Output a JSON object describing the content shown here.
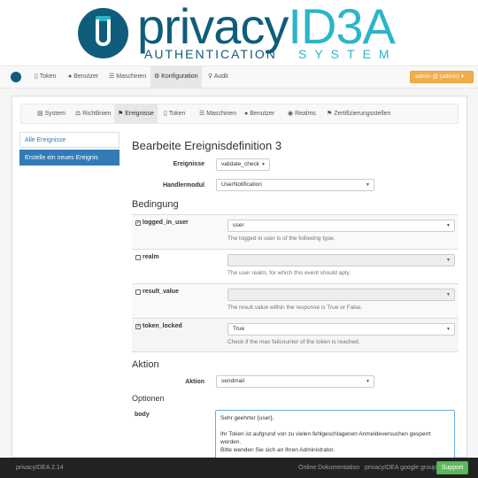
{
  "brand": {
    "name_part1": "privacy",
    "name_part2": "ID3A",
    "sub_part1": "AUTHENTICATION",
    "sub_part2": "SYSTEM"
  },
  "navbar": {
    "items": [
      {
        "label": "Token",
        "icon": "mobile-icon"
      },
      {
        "label": "Benutzer",
        "icon": "user-icon"
      },
      {
        "label": "Maschinen",
        "icon": "list-icon"
      },
      {
        "label": "Konfiguration",
        "icon": "gear-icon"
      },
      {
        "label": "Audit",
        "icon": "search-icon"
      }
    ],
    "admin_label": "admin @ (admin)"
  },
  "subnav": {
    "items": [
      {
        "label": "System"
      },
      {
        "label": "Richtlinien"
      },
      {
        "label": "Ereignisse"
      },
      {
        "label": "Token"
      },
      {
        "label": "Maschinen"
      },
      {
        "label": "Benutzer"
      },
      {
        "label": "Realms"
      },
      {
        "label": "Zertifizierungsstellen"
      }
    ]
  },
  "sidebar": {
    "items": [
      {
        "label": "Alle Ereignisse"
      },
      {
        "label": "Erstelle ein neues Ereignis"
      }
    ]
  },
  "main": {
    "title": "Bearbeite Ereignisdefinition 3",
    "events_label": "Ereignisse",
    "events_value": "validate_check",
    "handler_label": "Handlermodul",
    "handler_value": "UserNotification",
    "condition_heading": "Bedingung",
    "conditions": [
      {
        "name": "logged_in_user",
        "checked": true,
        "value": "user",
        "help": "The logged in user is of the following type."
      },
      {
        "name": "realm",
        "checked": false,
        "value": "",
        "help": "The user realm, for which this event should aply."
      },
      {
        "name": "result_value",
        "checked": false,
        "value": "",
        "help": "The result.value within the response is True or False."
      },
      {
        "name": "token_locked",
        "checked": true,
        "value": "True",
        "help": "Check if the max failcounter of the token is reached."
      }
    ],
    "action_heading": "Aktion",
    "action_label": "Aktion",
    "action_value": "sendmail",
    "options_heading": "Optionen",
    "body_label": "body",
    "body_text": "Sehr geehrter {user},\n\nIhr Token ist aufgrund von zu vielen fehlgeschlagenen Anmeldeversuchen gesperrt worden.\nBitte wenden Sie sich an Ihren Administrator."
  },
  "footer": {
    "version": "privacyIDEA 2.14",
    "docs_link": "Online Dokumentation",
    "group_link": "privacyIDEA google group",
    "support_label": "Support"
  },
  "colors": {
    "brand_dark": "#0f5d7a",
    "brand_light": "#2bb5c9",
    "primary": "#337ab7",
    "warning": "#f0ad4e",
    "success": "#5cb85c"
  }
}
